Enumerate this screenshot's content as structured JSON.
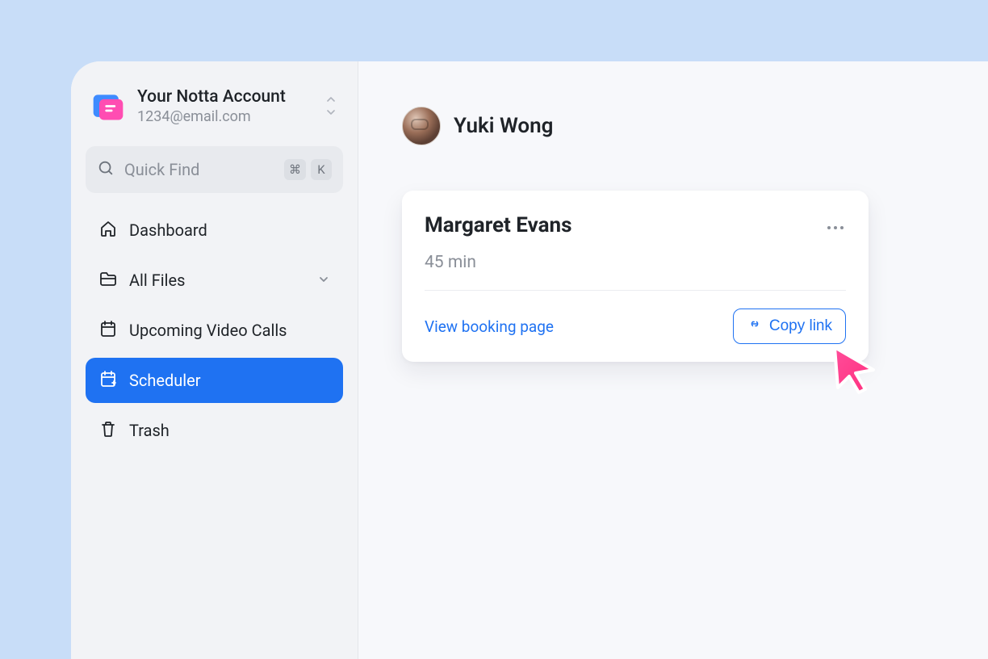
{
  "account": {
    "title": "Your Notta Account",
    "email": "1234@email.com"
  },
  "search": {
    "placeholder": "Quick Find",
    "shortcut_cmd": "⌘",
    "shortcut_key": "K"
  },
  "nav": {
    "dashboard": "Dashboard",
    "all_files": "All Files",
    "upcoming_calls": "Upcoming Video Calls",
    "scheduler": "Scheduler",
    "trash": "Trash"
  },
  "main": {
    "owner_name": "Yuki Wong"
  },
  "card": {
    "title": "Margaret Evans",
    "duration": "45 min",
    "view_booking_label": "View booking page",
    "copy_link_label": "Copy link"
  }
}
